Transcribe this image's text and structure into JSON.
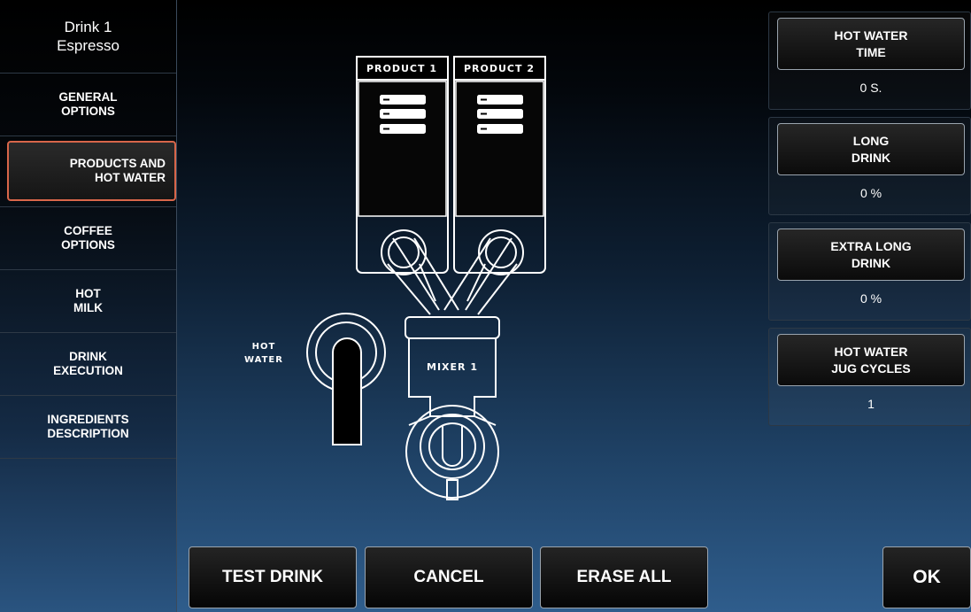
{
  "sidebar": {
    "drink_number": "Drink 1",
    "drink_name": "Espresso",
    "items": [
      {
        "label": "GENERAL\nOPTIONS"
      },
      {
        "label": "PRODUCTS AND\nHOT WATER"
      },
      {
        "label": "COFFEE\nOPTIONS"
      },
      {
        "label": "HOT\nMILK"
      },
      {
        "label": "DRINK\nEXECUTION"
      },
      {
        "label": "INGREDIENTS\nDESCRIPTION"
      }
    ]
  },
  "diagram": {
    "product1": "PRODUCT 1",
    "product2": "PRODUCT 2",
    "hot_water_line1": "HOT",
    "hot_water_line2": "WATER",
    "mixer": "MIXER 1"
  },
  "right_panel": {
    "cards": [
      {
        "label": "HOT WATER\nTIME",
        "value": "0 S."
      },
      {
        "label": "LONG\nDRINK",
        "value": "0 %"
      },
      {
        "label": "EXTRA LONG\nDRINK",
        "value": "0 %"
      },
      {
        "label": "HOT WATER\nJUG CYCLES",
        "value": "1"
      }
    ]
  },
  "bottom": {
    "test_drink": "TEST DRINK",
    "cancel": "CANCEL",
    "erase_all": "ERASE ALL",
    "ok": "OK"
  },
  "colors": {
    "active_border": "#d8664a",
    "diagram_stroke": "#ffffff"
  }
}
